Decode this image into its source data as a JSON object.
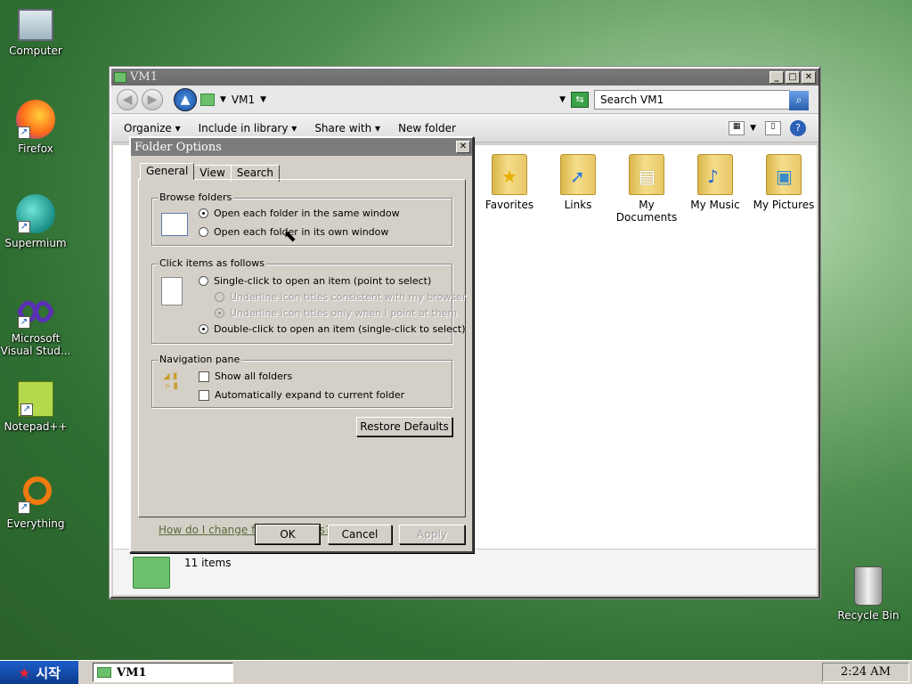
{
  "desktop": {
    "icons": [
      {
        "label": "Computer"
      },
      {
        "label": "Firefox"
      },
      {
        "label": "Supermium"
      },
      {
        "label": "Microsoft Visual Stud..."
      },
      {
        "label": "Notepad++"
      },
      {
        "label": "Everything"
      },
      {
        "label": "Recycle Bin"
      }
    ]
  },
  "explorer": {
    "title": "VM1",
    "address": "VM1",
    "search_placeholder": "Search VM1",
    "toolbar": {
      "organize": "Organize ▾",
      "include": "Include in library ▾",
      "share": "Share with ▾",
      "new_folder": "New folder"
    },
    "folders": [
      {
        "label": "Favorites"
      },
      {
        "label": "Links"
      },
      {
        "label": "My Documents"
      },
      {
        "label": "My Music"
      },
      {
        "label": "My Pictures"
      }
    ],
    "status": "11 items"
  },
  "dialog": {
    "title": "Folder Options",
    "tabs": [
      "General",
      "View",
      "Search"
    ],
    "browse_legend": "Browse folders",
    "browse_same": "Open each folder in the same window",
    "browse_own": "Open each folder in its own window",
    "click_legend": "Click items as follows",
    "single_click": "Single-click to open an item (point to select)",
    "underline_browser": "Underline icon titles consistent with my browser",
    "underline_point": "Underline icon titles only when I point at them",
    "double_click": "Double-click to open an item (single-click to select)",
    "nav_legend": "Navigation pane",
    "show_all": "Show all folders",
    "auto_expand": "Automatically expand to current folder",
    "restore": "Restore Defaults",
    "help_link": "How do I change folder options?",
    "ok": "OK",
    "cancel": "Cancel",
    "apply": "Apply"
  },
  "taskbar": {
    "start": "시작",
    "task": "VM1",
    "clock": "2:24 AM"
  }
}
